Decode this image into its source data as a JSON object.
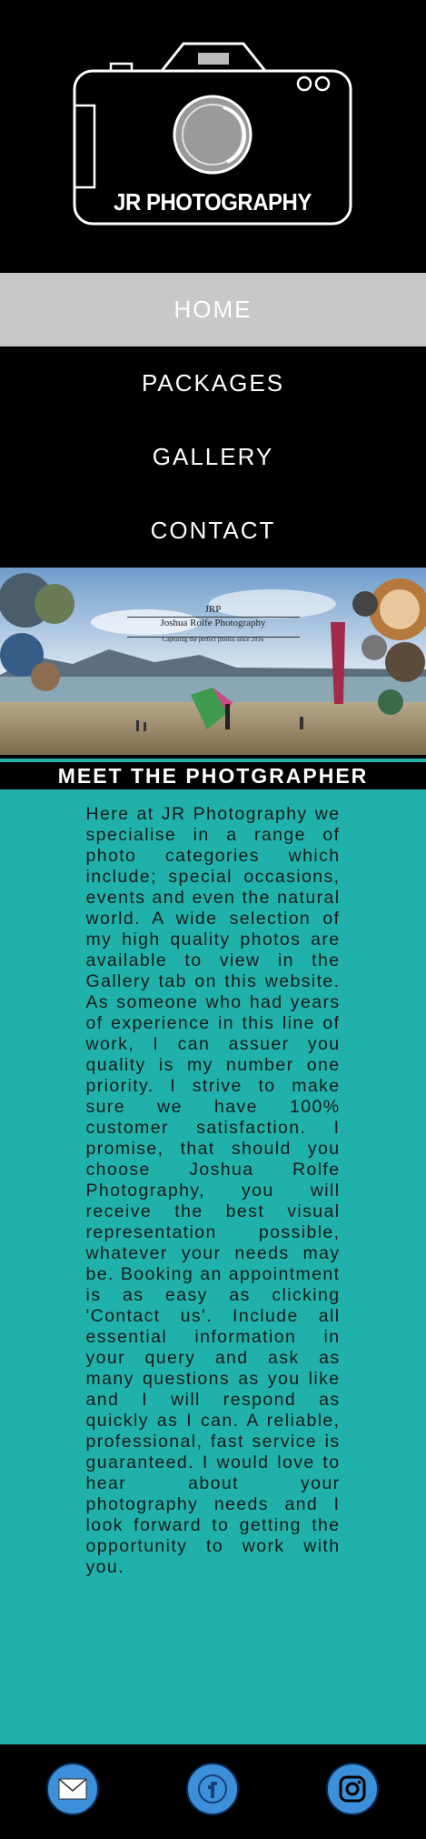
{
  "logo": {
    "text": "JR PHOTOGRAPHY"
  },
  "nav": {
    "items": [
      {
        "label": "HOME",
        "active": true
      },
      {
        "label": "PACKAGES",
        "active": false
      },
      {
        "label": "GALLERY",
        "active": false
      },
      {
        "label": "CONTACT",
        "active": false
      }
    ]
  },
  "banner": {
    "monogram": "JRP",
    "name": "Joshua Rolfe Photography",
    "tagline": "Capturing the perfect photos since 2016"
  },
  "section": {
    "heading": "MEET THE PHOTGRAPHER",
    "body": "Here at JR Photography we specialise in a range of photo categories which include; special occasions, events and even the natural world. A wide selection of my high quality photos are available to view in the Gallery tab on this website. As someone who had years of experience in this line of work, I can assuer you quality is my number one priority. I strive to make sure we have 100% customer satisfaction. I promise, that should you choose Joshua Rolfe Photography, you will receive the best visual representation possible, whatever your needs may be. Booking an appointment is as easy as clicking 'Contact us'. Include all essential information in your query and ask as many questions as you like and I will respond as quickly as I can. A reliable, professional, fast service is guaranteed. I would love to hear about your photography needs and I look forward to getting the opportunity to work with you."
  },
  "footer": {
    "icons": [
      "mail-icon",
      "facebook-icon",
      "instagram-icon"
    ],
    "accent": "#3c8fd9"
  },
  "colors": {
    "teal": "#20b2aa",
    "active_nav": "#c8c8c8"
  }
}
